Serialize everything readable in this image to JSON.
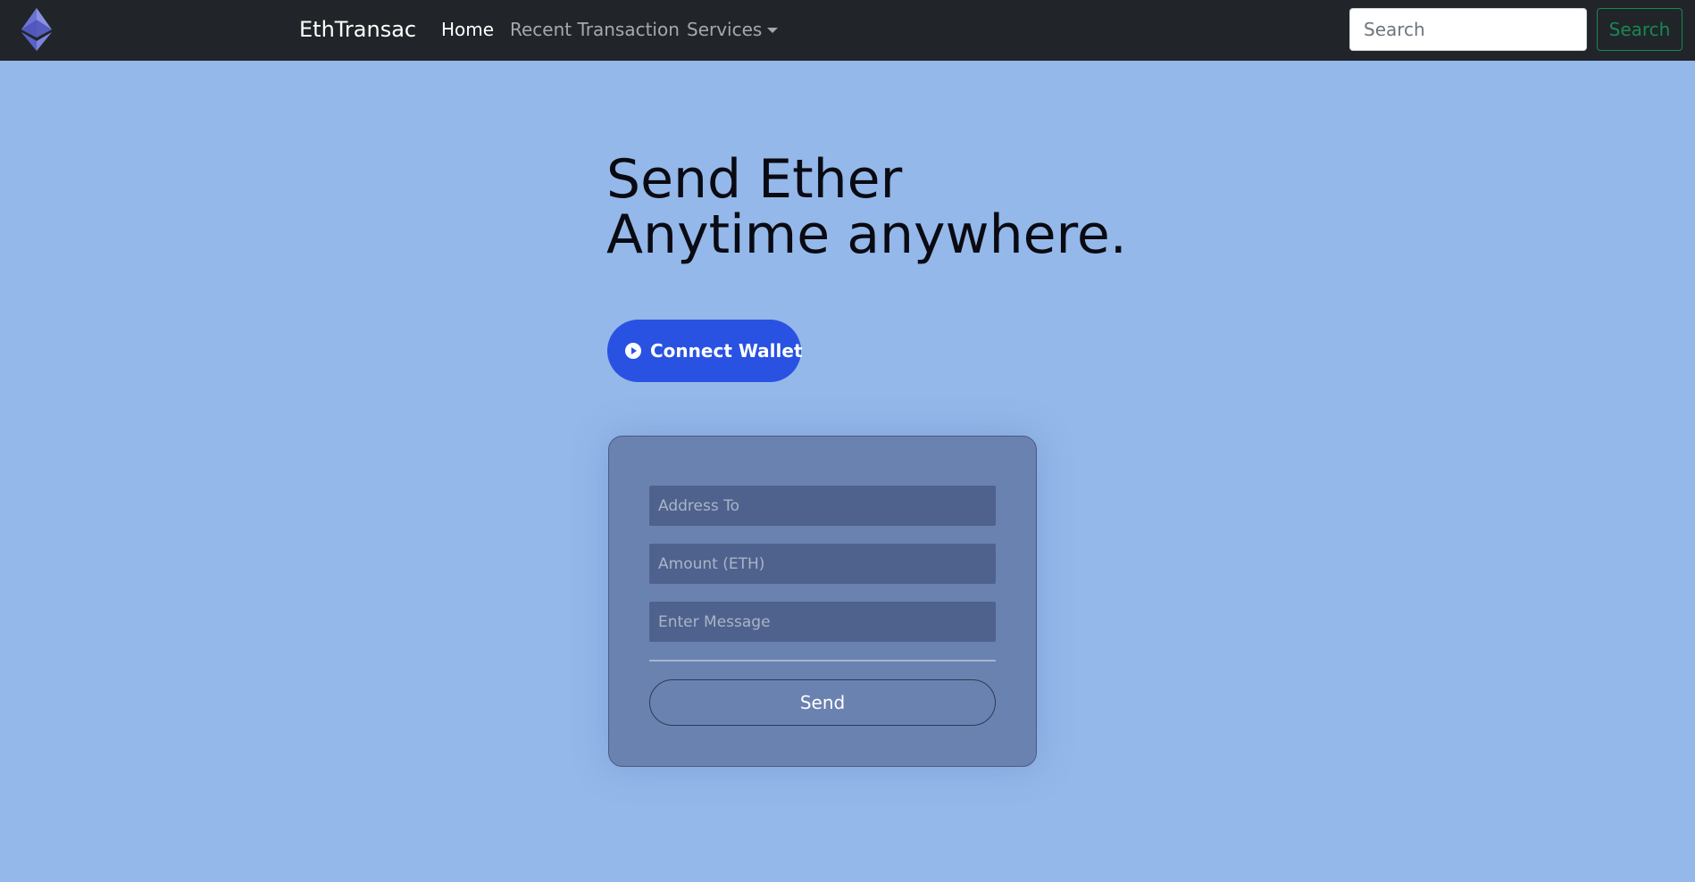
{
  "navbar": {
    "brand": "EthTransac",
    "links": [
      {
        "label": "Home",
        "active": true
      },
      {
        "label": "Recent Transaction",
        "active": false
      },
      {
        "label": "Services",
        "active": false,
        "dropdown": true
      }
    ],
    "search": {
      "placeholder": "Search",
      "button_label": "Search"
    },
    "logo_icon": "ethereum-logo-icon"
  },
  "hero": {
    "title_line1": "Send Ether",
    "title_line2": "Anytime anywhere.",
    "connect_label": "Connect Wallet",
    "connect_icon": "play-circle-icon"
  },
  "form": {
    "address_placeholder": "Address To",
    "amount_placeholder": "Amount (ETH)",
    "message_placeholder": "Enter Message",
    "send_label": "Send"
  },
  "colors": {
    "navbar_bg": "#212529",
    "page_bg": "#94b8e9",
    "connect_button": "#2952e3",
    "card_bg": "#6a82b0",
    "input_bg": "#4f628d",
    "search_button_accent": "#198754"
  }
}
